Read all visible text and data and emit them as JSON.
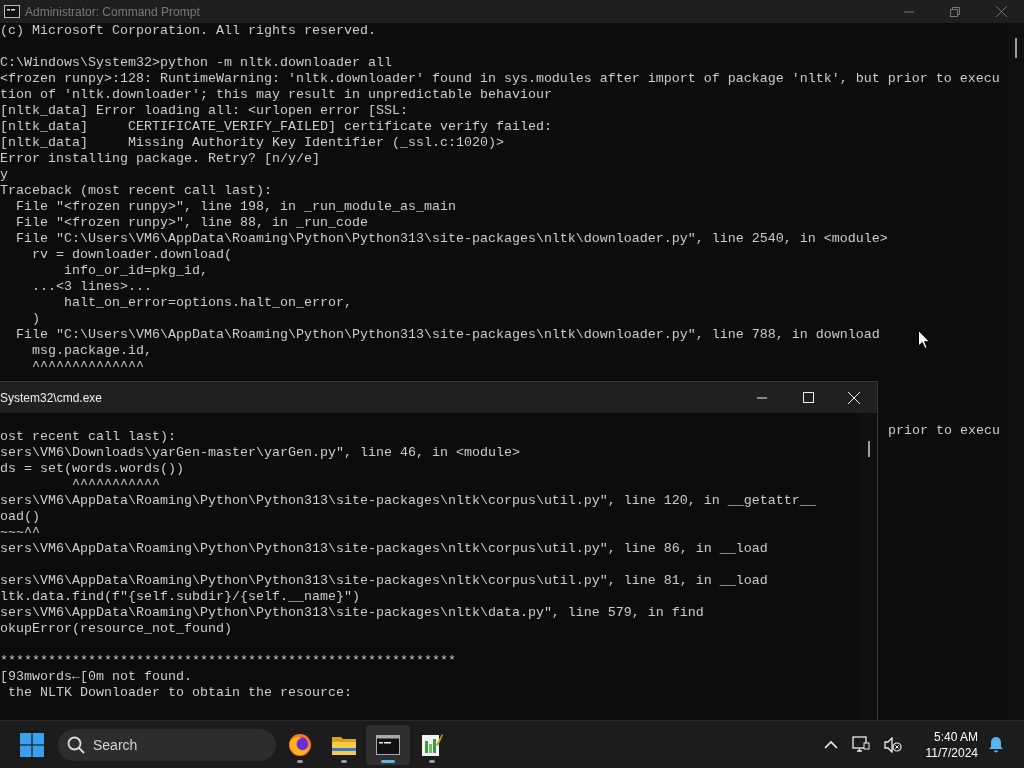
{
  "back_window": {
    "title": "Administrator: Command Prompt",
    "active": false,
    "blocks": [
      [
        "(c) Microsoft Corporation. All rights reserved."
      ],
      [
        "C:\\Windows\\System32>python -m nltk.downloader all",
        "<frozen runpy>:128: RuntimeWarning: 'nltk.downloader' found in sys.modules after import of package 'nltk', but prior to execu",
        "tion of 'nltk.downloader'; this may result in unpredictable behaviour",
        "[nltk_data] Error loading all: <urlopen error [SSL:",
        "[nltk_data]     CERTIFICATE_VERIFY_FAILED] certificate verify failed:",
        "[nltk_data]     Missing Authority Key Identifier (_ssl.c:1020)>",
        "Error installing package. Retry? [n/y/e]",
        "y",
        "Traceback (most recent call last):",
        "  File \"<frozen runpy>\", line 198, in _run_module_as_main",
        "  File \"<frozen runpy>\", line 88, in _run_code",
        "  File \"C:\\Users\\VM6\\AppData\\Roaming\\Python\\Python313\\site-packages\\nltk\\downloader.py\", line 2540, in <module>",
        "    rv = downloader.download(",
        "        info_or_id=pkg_id,",
        "    ...<3 lines>...",
        "        halt_on_error=options.halt_on_error,",
        "    )",
        "  File \"C:\\Users\\VM6\\AppData\\Roaming\\Python\\Python313\\site-packages\\nltk\\downloader.py\", line 788, in download",
        "    msg.package.id,",
        "    ^^^^^^^^^^^^^^"
      ]
    ],
    "uncovered_text": "prior to execu"
  },
  "front_window": {
    "title": "System32\\cmd.exe",
    "active": true,
    "blocks": [
      [
        "ost recent call last):",
        "sers\\VM6\\Downloads\\yarGen-master\\yarGen.py\", line 46, in <module>",
        "ds = set(words.words())",
        "         ^^^^^^^^^^^",
        "sers\\VM6\\AppData\\Roaming\\Python\\Python313\\site-packages\\nltk\\corpus\\util.py\", line 120, in __getattr__",
        "oad()",
        "~~~^^",
        "sers\\VM6\\AppData\\Roaming\\Python\\Python313\\site-packages\\nltk\\corpus\\util.py\", line 86, in __load"
      ],
      [
        "sers\\VM6\\AppData\\Roaming\\Python\\Python313\\site-packages\\nltk\\corpus\\util.py\", line 81, in __load",
        "ltk.data.find(f\"{self.subdir}/{self.__name}\")",
        "sers\\VM6\\AppData\\Roaming\\Python\\Python313\\site-packages\\nltk\\data.py\", line 579, in find",
        "okupError(resource_not_found)"
      ],
      [
        "*********************************************************",
        "[93mwords←[0m not found.",
        " the NLTK Downloader to obtain the resource:"
      ]
    ]
  },
  "taskbar": {
    "search": {
      "placeholder": "Search"
    },
    "apps": [
      {
        "kind": "browser",
        "selected": false
      },
      {
        "kind": "folder",
        "selected": false
      },
      {
        "kind": "terminal",
        "selected": true
      },
      {
        "kind": "editor",
        "selected": false
      }
    ],
    "clock": {
      "time": "5:40 AM",
      "date": "11/7/2024"
    }
  }
}
